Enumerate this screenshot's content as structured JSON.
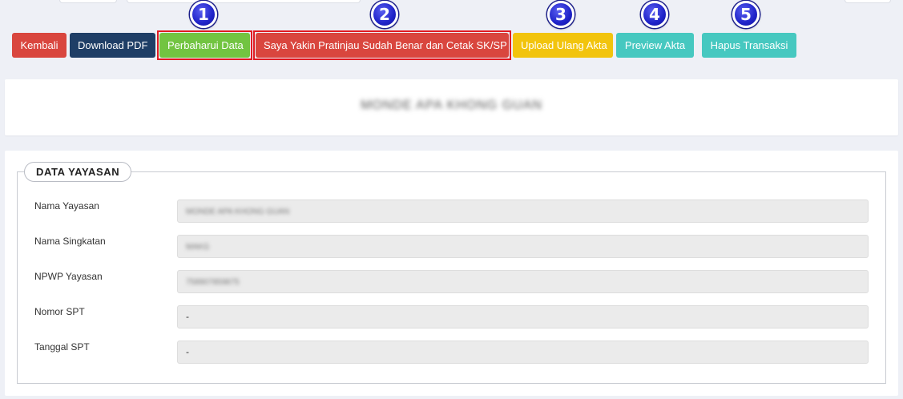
{
  "markers": [
    "1",
    "2",
    "3",
    "4",
    "5"
  ],
  "actions": {
    "back": "Kembali",
    "download_pdf": "Download PDF",
    "update_data": "Perbaharui Data",
    "confirm_print": "Saya Yakin Pratinjau Sudah Benar dan Cetak SK/SP",
    "reupload_deed": "Upload Ulang Akta",
    "preview_deed": "Preview Akta",
    "delete_transaction": "Hapus Transaksi"
  },
  "header": {
    "foundation_name_blurred": "MONDE APA KHONG GUAN"
  },
  "section": {
    "legend": "DATA YAYASAN"
  },
  "fields": [
    {
      "label": "Nama Yayasan",
      "value": "MONDE APA KHONG GUAN"
    },
    {
      "label": "Nama Singkatan",
      "value": "MAKG"
    },
    {
      "label": "NPWP Yayasan",
      "value": "758907859875"
    },
    {
      "label": "Nomor SPT",
      "value": "-"
    },
    {
      "label": "Tanggal SPT",
      "value": "-"
    }
  ],
  "colors": {
    "btn_back": "#d9463e",
    "btn_download": "#1f3e66",
    "btn_update": "#72c441",
    "btn_confirm": "#d9463e",
    "btn_reupload": "#f2c40d",
    "btn_preview": "#46c8c0",
    "btn_delete": "#46c8c0",
    "marker": "#1f23c9",
    "highlight": "#e01a22"
  }
}
